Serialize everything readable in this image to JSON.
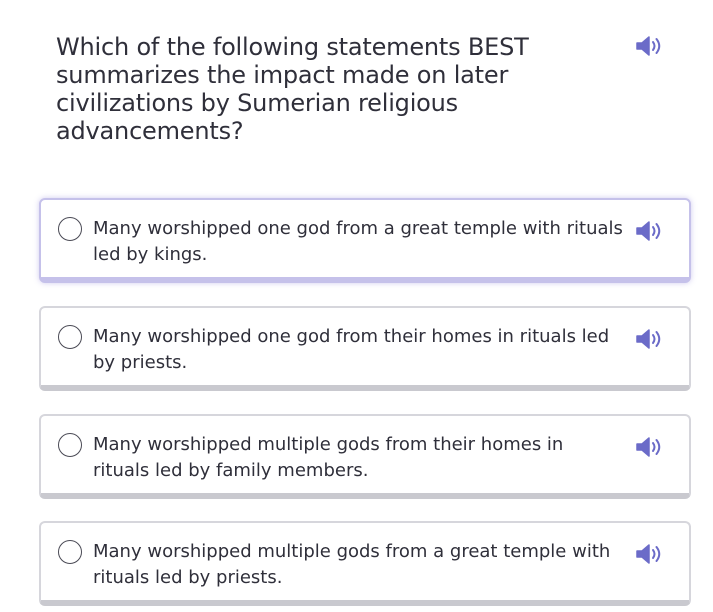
{
  "question": {
    "text": "Which of the following statements BEST summarizes the impact made on later civilizations by Sumerian religious advancements?",
    "audio_icon": "speaker-icon"
  },
  "options": [
    {
      "text": "Many worshipped one god from a great temple with rituals led by kings.",
      "selected": true
    },
    {
      "text": "Many worshipped one god from their homes in rituals led by priests.",
      "selected": false
    },
    {
      "text": "Many worshipped multiple gods from their homes in rituals led by family members.",
      "selected": false
    },
    {
      "text": "Many worshipped multiple gods from a great temple with rituals led by priests.",
      "selected": false
    }
  ],
  "colors": {
    "speaker": "#6b6bc8",
    "selected_border": "#c5c1ea",
    "border": "#d6d6dc"
  }
}
